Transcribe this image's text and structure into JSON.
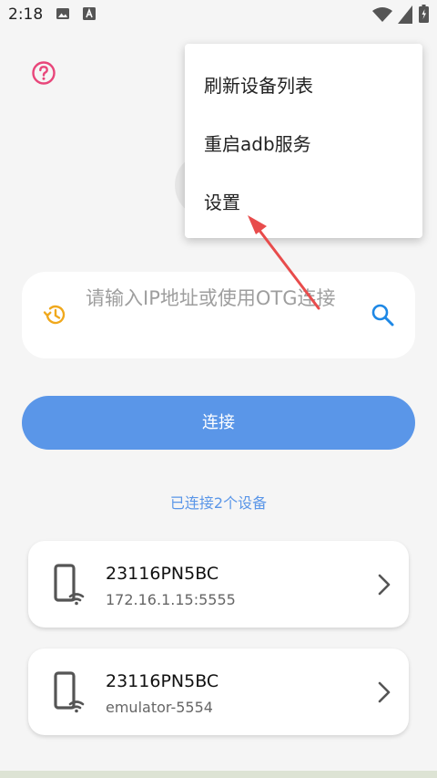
{
  "status_bar": {
    "time": "2:18"
  },
  "search": {
    "placeholder": "请输入IP地址或使用OTG连接"
  },
  "connect_button": {
    "label": "连接"
  },
  "connected_count": "已连接2个设备",
  "devices": [
    {
      "name": "23116PN5BC",
      "address": "172.16.1.15:5555"
    },
    {
      "name": "23116PN5BC",
      "address": "emulator-5554"
    }
  ],
  "menu": {
    "items": [
      {
        "label": "刷新设备列表"
      },
      {
        "label": "重启adb服务"
      },
      {
        "label": "设置"
      }
    ]
  },
  "colors": {
    "accent": "#5a96e8",
    "help": "#e8467a",
    "history": "#f0a81c",
    "search": "#1e88e5",
    "annotation_arrow": "#e84c4c"
  },
  "icons": [
    "help-icon",
    "history-icon",
    "search-icon",
    "phone-wifi-icon",
    "chevron-right-icon",
    "image-icon",
    "font-icon",
    "wifi-icon",
    "battery-icon"
  ]
}
